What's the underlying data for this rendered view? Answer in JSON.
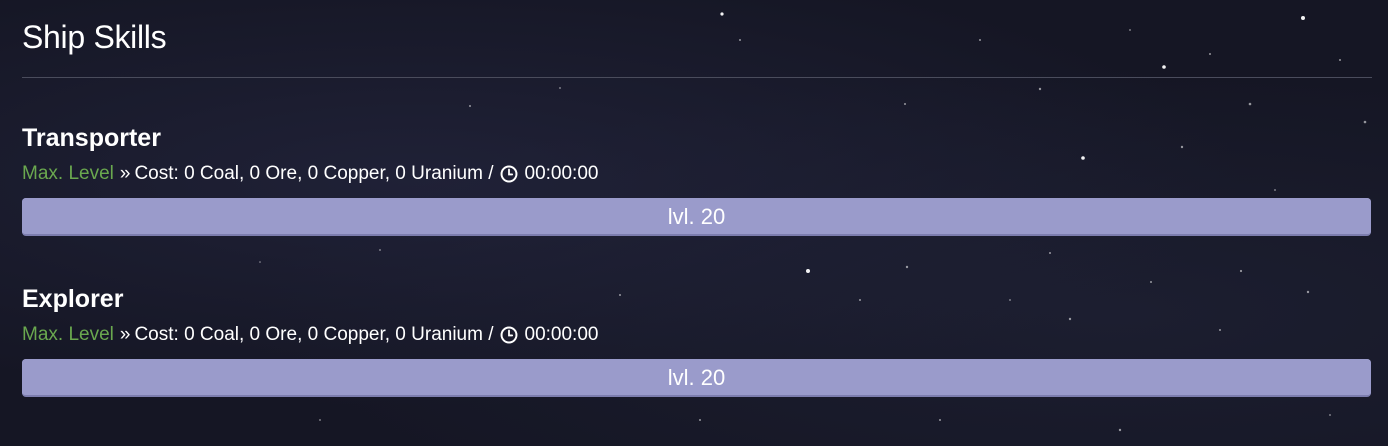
{
  "page": {
    "title": "Ship Skills"
  },
  "skills": [
    {
      "name": "Transporter",
      "status": "Max. Level",
      "separator": "»",
      "cost_text": "Cost: 0 Coal, 0 Ore, 0 Copper, 0 Uranium /",
      "time": "00:00:00",
      "level_label": "lvl. 20",
      "progress_fraction": 1.0
    },
    {
      "name": "Explorer",
      "status": "Max. Level",
      "separator": "»",
      "cost_text": "Cost: 0 Coal, 0 Ore, 0 Copper, 0 Uranium /",
      "time": "00:00:00",
      "level_label": "lvl. 20",
      "progress_fraction": 1.0
    }
  ],
  "icons": {
    "time": "clock-icon"
  },
  "colors": {
    "background": "#151624",
    "status_max": "#6aa84f",
    "level_bar": "#9a9bcb",
    "divider": "#4a4c5c"
  }
}
